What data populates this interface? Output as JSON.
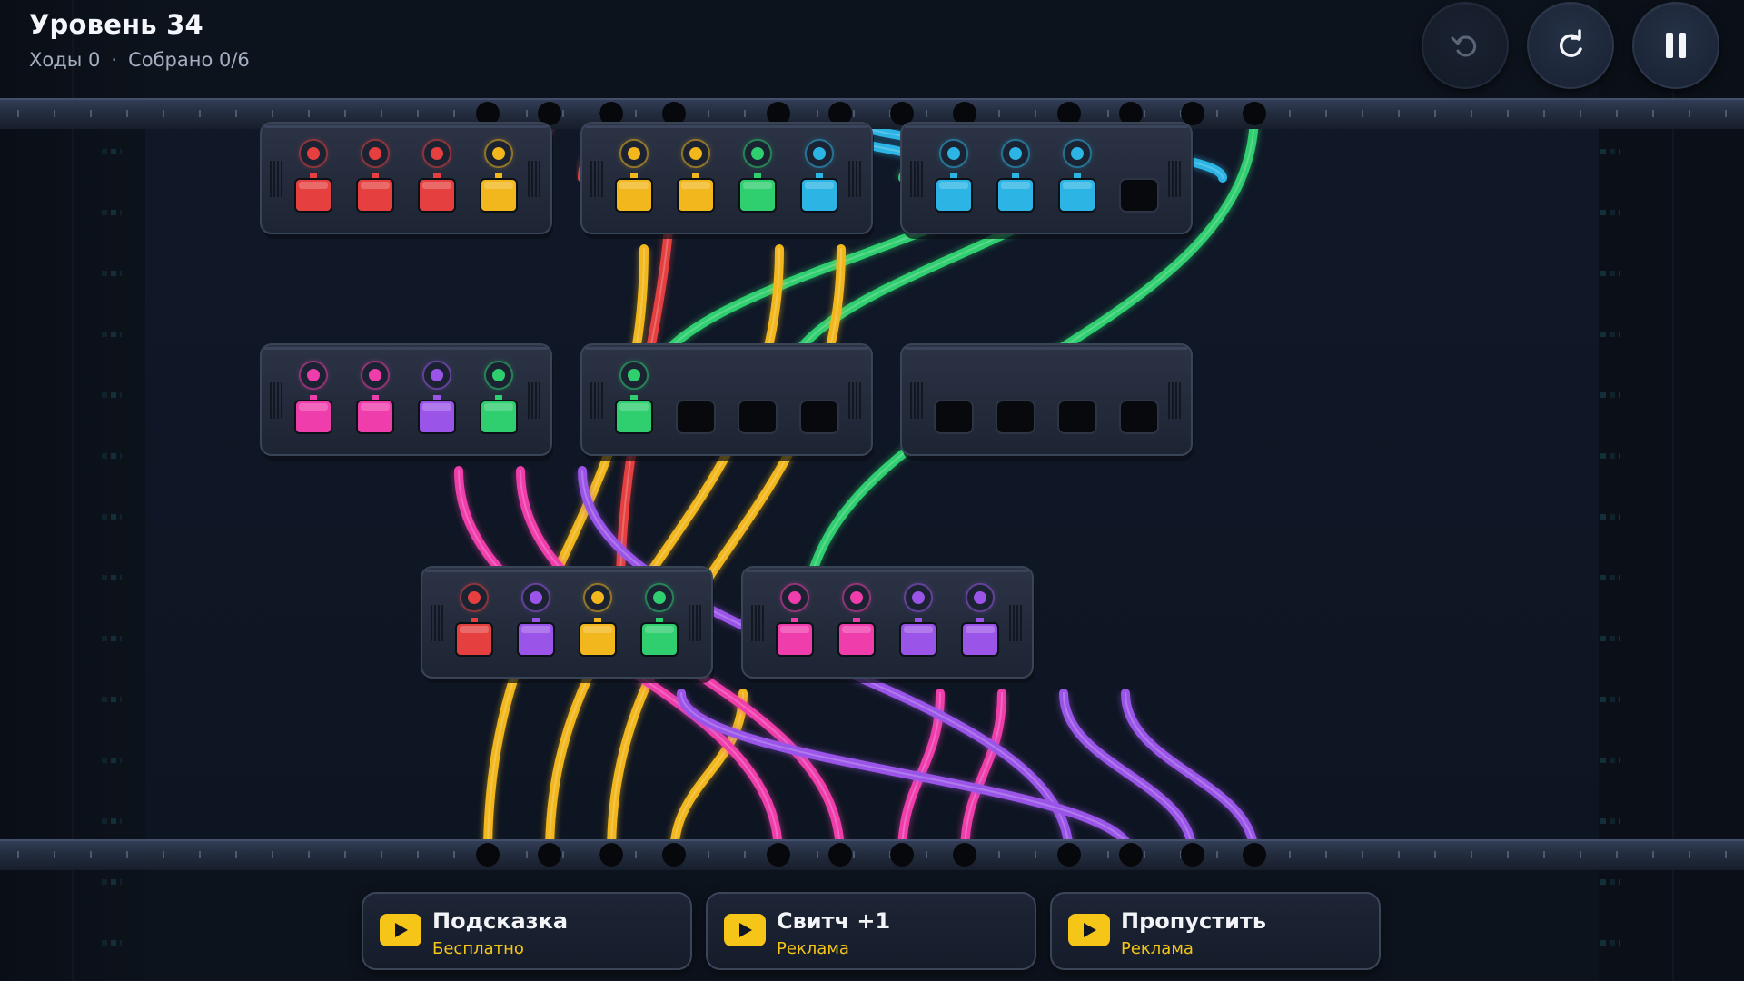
{
  "hud": {
    "title": "Уровень 34",
    "moves_label": "Ходы 0",
    "separator": "·",
    "collected_label": "Собрано 0/6"
  },
  "controls": {
    "undo_icon": "undo-icon",
    "undo_enabled": false,
    "restart_icon": "restart-icon",
    "pause_icon": "pause-icon"
  },
  "colors": {
    "red": "#e5403f",
    "yellow": "#f2b71c",
    "green": "#2fce6f",
    "blue": "#2bb4e4",
    "pink": "#ef3dab",
    "purple": "#9a55e8",
    "accent": "#f5c518"
  },
  "switches": [
    {
      "id": "s1",
      "ports": [
        "red",
        "red",
        "red",
        "yellow"
      ]
    },
    {
      "id": "s2",
      "ports": [
        "yellow",
        "yellow",
        "green",
        "blue"
      ]
    },
    {
      "id": "s3",
      "ports": [
        "blue",
        "blue",
        "blue",
        null
      ]
    },
    {
      "id": "s4",
      "ports": [
        "pink",
        "pink",
        "purple",
        "green"
      ]
    },
    {
      "id": "s5",
      "ports": [
        "green",
        null,
        null,
        null
      ]
    },
    {
      "id": "s6",
      "ports": [
        null,
        null,
        null,
        null
      ]
    },
    {
      "id": "s7",
      "ports": [
        "red",
        "purple",
        "yellow",
        "green"
      ]
    },
    {
      "id": "s8",
      "ports": [
        "pink",
        "pink",
        "purple",
        "purple"
      ]
    }
  ],
  "cables": [
    {
      "color": "red",
      "from": [
        "top",
        1
      ],
      "to": [
        "s1",
        0
      ]
    },
    {
      "color": "red",
      "from": [
        "top",
        2
      ],
      "to": [
        "s1",
        1
      ]
    },
    {
      "color": "red",
      "from": [
        "top",
        3
      ],
      "to": [
        "s1",
        2
      ]
    },
    {
      "color": "red",
      "from": [
        "top",
        4
      ],
      "to": [
        "s7",
        0
      ]
    },
    {
      "color": "blue",
      "from": [
        "top",
        5
      ],
      "to": [
        "s2",
        3
      ]
    },
    {
      "color": "blue",
      "from": [
        "top",
        6
      ],
      "to": [
        "s3",
        0
      ]
    },
    {
      "color": "blue",
      "from": [
        "top",
        7
      ],
      "to": [
        "s3",
        1
      ]
    },
    {
      "color": "blue",
      "from": [
        "top",
        8
      ],
      "to": [
        "s3",
        2
      ]
    },
    {
      "color": "green",
      "from": [
        "top",
        9
      ],
      "to": [
        "s4",
        3
      ]
    },
    {
      "color": "green",
      "from": [
        "top",
        10
      ],
      "to": [
        "s5",
        0
      ]
    },
    {
      "color": "green",
      "from": [
        "top",
        11
      ],
      "to": [
        "s2",
        2
      ]
    },
    {
      "color": "green",
      "from": [
        "top",
        12
      ],
      "to": [
        "s7",
        3
      ]
    },
    {
      "color": "yellow",
      "from": [
        "bottom",
        1
      ],
      "to": [
        "s1",
        3
      ]
    },
    {
      "color": "yellow",
      "from": [
        "bottom",
        2
      ],
      "to": [
        "s2",
        0
      ]
    },
    {
      "color": "yellow",
      "from": [
        "bottom",
        3
      ],
      "to": [
        "s2",
        1
      ]
    },
    {
      "color": "yellow",
      "from": [
        "bottom",
        4
      ],
      "to": [
        "s7",
        2
      ]
    },
    {
      "color": "pink",
      "from": [
        "bottom",
        5
      ],
      "to": [
        "s4",
        0
      ]
    },
    {
      "color": "pink",
      "from": [
        "bottom",
        6
      ],
      "to": [
        "s4",
        1
      ]
    },
    {
      "color": "pink",
      "from": [
        "bottom",
        7
      ],
      "to": [
        "s8",
        0
      ]
    },
    {
      "color": "pink",
      "from": [
        "bottom",
        8
      ],
      "to": [
        "s8",
        1
      ]
    },
    {
      "color": "purple",
      "from": [
        "bottom",
        9
      ],
      "to": [
        "s4",
        2
      ]
    },
    {
      "color": "purple",
      "from": [
        "bottom",
        10
      ],
      "to": [
        "s7",
        1
      ]
    },
    {
      "color": "purple",
      "from": [
        "bottom",
        11
      ],
      "to": [
        "s8",
        2
      ]
    },
    {
      "color": "purple",
      "from": [
        "bottom",
        12
      ],
      "to": [
        "s8",
        3
      ]
    }
  ],
  "actions": [
    {
      "id": "hint",
      "label": "Подсказка",
      "sub": "Бесплатно",
      "icon": "play-ad-icon"
    },
    {
      "id": "switch-plus",
      "label": "Свитч +1",
      "sub": "Реклама",
      "icon": "play-ad-icon"
    },
    {
      "id": "skip",
      "label": "Пропустить",
      "sub": "Реклама",
      "icon": "play-ad-icon"
    }
  ]
}
